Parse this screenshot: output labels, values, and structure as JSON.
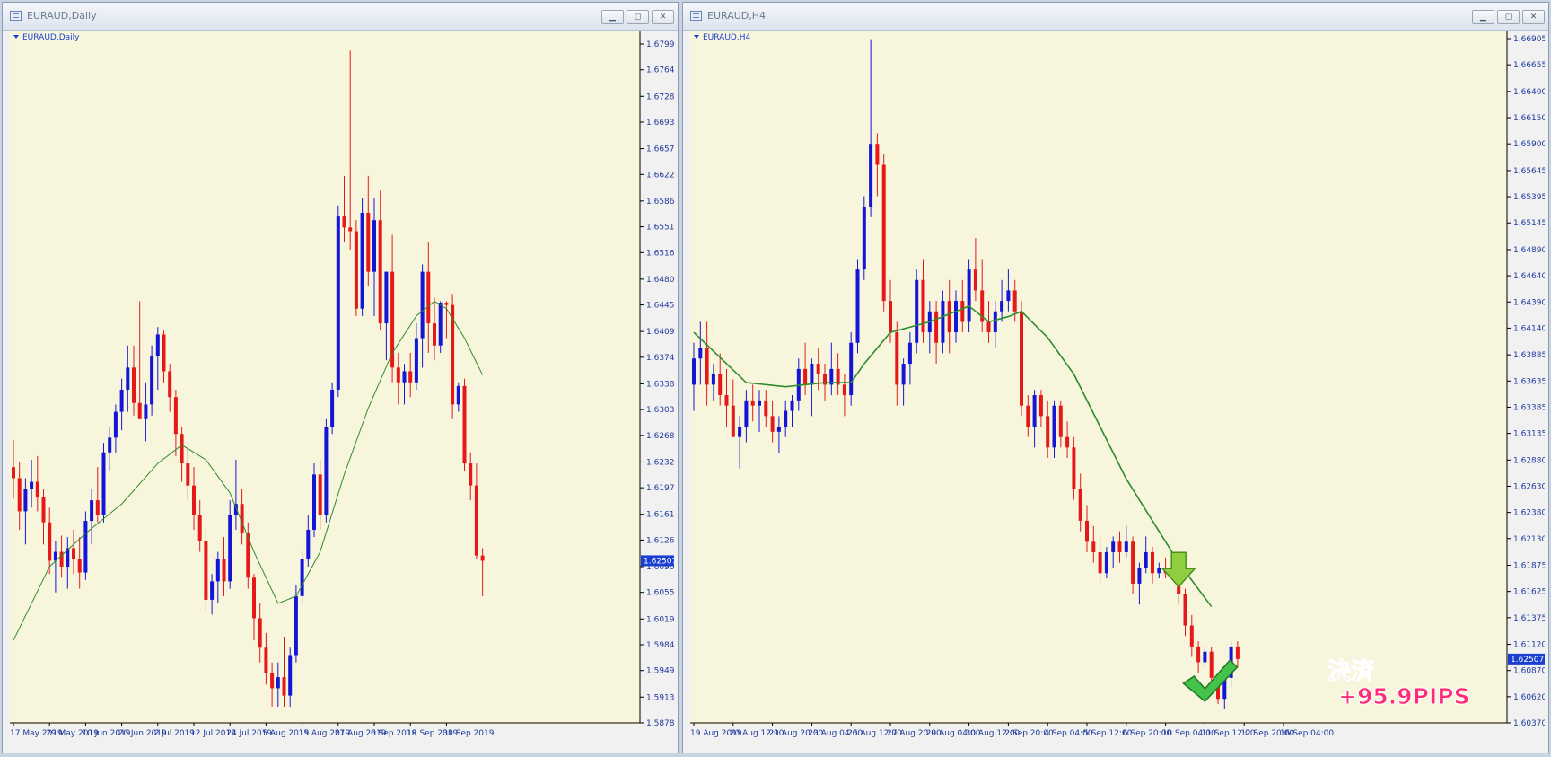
{
  "windows": {
    "left": {
      "title": "EURAUD,Daily",
      "label": "EURAUD,Daily",
      "price_tag": "1.62507",
      "y_ticks": [
        "1.67990",
        "1.67640",
        "1.67280",
        "1.66930",
        "1.66570",
        "1.66220",
        "1.65860",
        "1.65510",
        "1.65160",
        "1.64800",
        "1.64450",
        "1.64090",
        "1.63740",
        "1.63380",
        "1.63030",
        "1.62680",
        "1.62320",
        "1.61970",
        "1.61610",
        "1.61260",
        "1.60900",
        "1.60550",
        "1.60190",
        "1.59840",
        "1.59490",
        "1.59130",
        "1.58780"
      ],
      "x_ticks": [
        "17 May 2019",
        "29 May 2019",
        "10 Jun 2019",
        "20 Jun 2019",
        "2 Jul 2019",
        "12 Jul 2019",
        "24 Jul 2019",
        "5 Aug 2019",
        "15 Aug 2019",
        "27 Aug 2019",
        "6 Sep 2019",
        "18 Sep 2019",
        "30 Sep 2019"
      ]
    },
    "right": {
      "title": "EURAUD,H4",
      "label": "EURAUD,H4",
      "price_tag": "1.62507",
      "y_ticks": [
        "1.66905",
        "1.66655",
        "1.66400",
        "1.66150",
        "1.65900",
        "1.65645",
        "1.65395",
        "1.65145",
        "1.64890",
        "1.64640",
        "1.64390",
        "1.64140",
        "1.63885",
        "1.63635",
        "1.63385",
        "1.63135",
        "1.62880",
        "1.62630",
        "1.62380",
        "1.62130",
        "1.61875",
        "1.61625",
        "1.61375",
        "1.61120",
        "1.60870",
        "1.60620",
        "1.60370"
      ],
      "x_ticks": [
        "19 Aug 2019",
        "20 Aug 12:00",
        "21 Aug 20:00",
        "23 Aug 04:00",
        "26 Aug 12:00",
        "27 Aug 20:00",
        "29 Aug 04:00",
        "30 Aug 12:00",
        "2 Sep 20:00",
        "4 Sep 04:00",
        "5 Sep 12:00",
        "6 Sep 20:00",
        "10 Sep 04:00",
        "11 Sep 12:00",
        "12 Sep 20:00",
        "16 Sep 04:00"
      ],
      "annotation": {
        "line1": "決済",
        "line2": "+95.9PIPS"
      }
    }
  },
  "colors": {
    "background": "#f7f5dc",
    "bull": "#1515d6",
    "bear": "#e61919",
    "ma": "#2e8b2e",
    "axis_text": "#1f3a9e",
    "price_tag_bg": "#1a3fd0"
  },
  "chart_data": [
    {
      "type": "candlestick",
      "symbol": "EURAUD",
      "timeframe": "Daily",
      "ylim": [
        1.5878,
        1.6799
      ],
      "candles": [
        [
          1.6225,
          1.6262,
          1.6182,
          1.621
        ],
        [
          1.621,
          1.6232,
          1.614,
          1.6165
        ],
        [
          1.6165,
          1.621,
          1.612,
          1.6195
        ],
        [
          1.6195,
          1.6235,
          1.617,
          1.6205
        ],
        [
          1.6205,
          1.624,
          1.6165,
          1.6185
        ],
        [
          1.6185,
          1.6195,
          1.612,
          1.615
        ],
        [
          1.615,
          1.617,
          1.608,
          1.6098
        ],
        [
          1.6098,
          1.6125,
          1.6055,
          1.611
        ],
        [
          1.611,
          1.6132,
          1.6075,
          1.609
        ],
        [
          1.609,
          1.613,
          1.606,
          1.6115
        ],
        [
          1.6115,
          1.614,
          1.608,
          1.61
        ],
        [
          1.61,
          1.613,
          1.606,
          1.6082
        ],
        [
          1.6082,
          1.6165,
          1.6072,
          1.6152
        ],
        [
          1.6152,
          1.6195,
          1.612,
          1.618
        ],
        [
          1.618,
          1.6225,
          1.615,
          1.616
        ],
        [
          1.616,
          1.6258,
          1.615,
          1.6245
        ],
        [
          1.6245,
          1.628,
          1.622,
          1.6265
        ],
        [
          1.6265,
          1.631,
          1.6245,
          1.63
        ],
        [
          1.63,
          1.6345,
          1.6275,
          1.633
        ],
        [
          1.633,
          1.639,
          1.63,
          1.636
        ],
        [
          1.636,
          1.639,
          1.6295,
          1.6312
        ],
        [
          1.6312,
          1.645,
          1.6295,
          1.629
        ],
        [
          1.629,
          1.634,
          1.626,
          1.631
        ],
        [
          1.631,
          1.639,
          1.6295,
          1.6375
        ],
        [
          1.6375,
          1.6415,
          1.633,
          1.6405
        ],
        [
          1.6405,
          1.641,
          1.634,
          1.6355
        ],
        [
          1.6355,
          1.6365,
          1.63,
          1.632
        ],
        [
          1.632,
          1.633,
          1.624,
          1.627
        ],
        [
          1.627,
          1.628,
          1.6205,
          1.623
        ],
        [
          1.623,
          1.625,
          1.618,
          1.62
        ],
        [
          1.62,
          1.6225,
          1.614,
          1.616
        ],
        [
          1.616,
          1.618,
          1.611,
          1.6125
        ],
        [
          1.6125,
          1.614,
          1.603,
          1.6045
        ],
        [
          1.6045,
          1.608,
          1.6025,
          1.607
        ],
        [
          1.607,
          1.611,
          1.604,
          1.61
        ],
        [
          1.61,
          1.613,
          1.605,
          1.607
        ],
        [
          1.607,
          1.618,
          1.606,
          1.616
        ],
        [
          1.616,
          1.6235,
          1.614,
          1.6175
        ],
        [
          1.6175,
          1.6195,
          1.612,
          1.6135
        ],
        [
          1.6135,
          1.615,
          1.606,
          1.6075
        ],
        [
          1.6075,
          1.608,
          1.599,
          1.602
        ],
        [
          1.602,
          1.604,
          1.596,
          1.598
        ],
        [
          1.598,
          1.6,
          1.593,
          1.5945
        ],
        [
          1.5945,
          1.596,
          1.59,
          1.5925
        ],
        [
          1.5925,
          1.596,
          1.59,
          1.594
        ],
        [
          1.594,
          1.5995,
          1.59,
          1.5915
        ],
        [
          1.5915,
          1.598,
          1.59,
          1.597
        ],
        [
          1.597,
          1.6065,
          1.596,
          1.605
        ],
        [
          1.605,
          1.611,
          1.604,
          1.61
        ],
        [
          1.61,
          1.616,
          1.609,
          1.614
        ],
        [
          1.614,
          1.623,
          1.613,
          1.6215
        ],
        [
          1.6215,
          1.6235,
          1.614,
          1.616
        ],
        [
          1.616,
          1.629,
          1.615,
          1.628
        ],
        [
          1.628,
          1.634,
          1.627,
          1.633
        ],
        [
          1.633,
          1.658,
          1.632,
          1.6565
        ],
        [
          1.6565,
          1.662,
          1.653,
          1.655
        ],
        [
          1.655,
          1.679,
          1.652,
          1.6545
        ],
        [
          1.6545,
          1.656,
          1.643,
          1.644
        ],
        [
          1.644,
          1.659,
          1.643,
          1.657
        ],
        [
          1.657,
          1.662,
          1.647,
          1.649
        ],
        [
          1.649,
          1.659,
          1.643,
          1.656
        ],
        [
          1.656,
          1.66,
          1.641,
          1.642
        ],
        [
          1.642,
          1.649,
          1.637,
          1.649
        ],
        [
          1.649,
          1.654,
          1.634,
          1.636
        ],
        [
          1.636,
          1.638,
          1.631,
          1.634
        ],
        [
          1.634,
          1.6365,
          1.631,
          1.6355
        ],
        [
          1.6355,
          1.638,
          1.632,
          1.634
        ],
        [
          1.634,
          1.642,
          1.633,
          1.64
        ],
        [
          1.64,
          1.65,
          1.636,
          1.649
        ],
        [
          1.649,
          1.653,
          1.638,
          1.642
        ],
        [
          1.642,
          1.6455,
          1.637,
          1.639
        ],
        [
          1.639,
          1.645,
          1.638,
          1.6448
        ],
        [
          1.6448,
          1.645,
          1.64,
          1.6445
        ],
        [
          1.6445,
          1.646,
          1.629,
          1.631
        ],
        [
          1.631,
          1.634,
          1.63,
          1.6335
        ],
        [
          1.6335,
          1.6345,
          1.622,
          1.623
        ],
        [
          1.623,
          1.6245,
          1.618,
          1.62
        ],
        [
          1.62,
          1.623,
          1.61,
          1.6105
        ],
        [
          1.6105,
          1.6115,
          1.605,
          1.6098
        ]
      ],
      "ma": [
        [
          0,
          1.599
        ],
        [
          6,
          1.609
        ],
        [
          12,
          1.6135
        ],
        [
          18,
          1.6175
        ],
        [
          24,
          1.623
        ],
        [
          28,
          1.6255
        ],
        [
          32,
          1.6235
        ],
        [
          36,
          1.619
        ],
        [
          40,
          1.611
        ],
        [
          44,
          1.604
        ],
        [
          47,
          1.605
        ],
        [
          51,
          1.611
        ],
        [
          55,
          1.6215
        ],
        [
          59,
          1.6305
        ],
        [
          63,
          1.638
        ],
        [
          67,
          1.643
        ],
        [
          70,
          1.645
        ],
        [
          72,
          1.644
        ],
        [
          75,
          1.64
        ],
        [
          78,
          1.635
        ]
      ],
      "x_tick_index": [
        0,
        6,
        12,
        18,
        24,
        30,
        36,
        42,
        48,
        54,
        60,
        66,
        72
      ]
    },
    {
      "type": "candlestick",
      "symbol": "EURAUD",
      "timeframe": "H4",
      "ylim": [
        1.6037,
        1.66905
      ],
      "candles": [
        [
          1.636,
          1.64,
          1.6335,
          1.6385
        ],
        [
          1.6385,
          1.642,
          1.636,
          1.6395
        ],
        [
          1.6395,
          1.642,
          1.634,
          1.636
        ],
        [
          1.636,
          1.638,
          1.6345,
          1.637
        ],
        [
          1.637,
          1.639,
          1.634,
          1.635
        ],
        [
          1.635,
          1.6375,
          1.632,
          1.634
        ],
        [
          1.634,
          1.6365,
          1.632,
          1.631
        ],
        [
          1.631,
          1.633,
          1.628,
          1.632
        ],
        [
          1.632,
          1.6355,
          1.6305,
          1.6345
        ],
        [
          1.6345,
          1.636,
          1.6325,
          1.634
        ],
        [
          1.634,
          1.6355,
          1.6315,
          1.6345
        ],
        [
          1.6345,
          1.6355,
          1.632,
          1.633
        ],
        [
          1.633,
          1.6345,
          1.6305,
          1.6315
        ],
        [
          1.6315,
          1.633,
          1.6295,
          1.632
        ],
        [
          1.632,
          1.6345,
          1.631,
          1.6335
        ],
        [
          1.6335,
          1.635,
          1.632,
          1.6345
        ],
        [
          1.6345,
          1.6385,
          1.6335,
          1.6375
        ],
        [
          1.6375,
          1.64,
          1.635,
          1.636
        ],
        [
          1.636,
          1.6385,
          1.633,
          1.638
        ],
        [
          1.638,
          1.6395,
          1.6355,
          1.637
        ],
        [
          1.637,
          1.638,
          1.6345,
          1.636
        ],
        [
          1.636,
          1.64,
          1.635,
          1.6375
        ],
        [
          1.6375,
          1.639,
          1.635,
          1.636
        ],
        [
          1.636,
          1.637,
          1.633,
          1.635
        ],
        [
          1.635,
          1.641,
          1.634,
          1.64
        ],
        [
          1.64,
          1.648,
          1.639,
          1.647
        ],
        [
          1.647,
          1.654,
          1.646,
          1.653
        ],
        [
          1.653,
          1.669,
          1.652,
          1.659
        ],
        [
          1.659,
          1.66,
          1.654,
          1.657
        ],
        [
          1.657,
          1.658,
          1.643,
          1.644
        ],
        [
          1.644,
          1.646,
          1.64,
          1.641
        ],
        [
          1.641,
          1.642,
          1.634,
          1.636
        ],
        [
          1.636,
          1.6385,
          1.634,
          1.638
        ],
        [
          1.638,
          1.641,
          1.636,
          1.64
        ],
        [
          1.64,
          1.647,
          1.639,
          1.646
        ],
        [
          1.646,
          1.648,
          1.64,
          1.641
        ],
        [
          1.641,
          1.644,
          1.639,
          1.643
        ],
        [
          1.643,
          1.644,
          1.638,
          1.64
        ],
        [
          1.64,
          1.645,
          1.639,
          1.644
        ],
        [
          1.644,
          1.646,
          1.639,
          1.641
        ],
        [
          1.641,
          1.645,
          1.64,
          1.644
        ],
        [
          1.644,
          1.646,
          1.641,
          1.642
        ],
        [
          1.642,
          1.648,
          1.641,
          1.647
        ],
        [
          1.647,
          1.65,
          1.644,
          1.645
        ],
        [
          1.645,
          1.648,
          1.641,
          1.642
        ],
        [
          1.642,
          1.644,
          1.64,
          1.641
        ],
        [
          1.641,
          1.644,
          1.6395,
          1.643
        ],
        [
          1.643,
          1.646,
          1.642,
          1.644
        ],
        [
          1.644,
          1.647,
          1.643,
          1.645
        ],
        [
          1.645,
          1.646,
          1.642,
          1.643
        ],
        [
          1.643,
          1.644,
          1.633,
          1.634
        ],
        [
          1.634,
          1.635,
          1.631,
          1.632
        ],
        [
          1.632,
          1.6355,
          1.63,
          1.635
        ],
        [
          1.635,
          1.6355,
          1.632,
          1.633
        ],
        [
          1.633,
          1.6345,
          1.629,
          1.63
        ],
        [
          1.63,
          1.6345,
          1.629,
          1.634
        ],
        [
          1.634,
          1.6345,
          1.63,
          1.631
        ],
        [
          1.631,
          1.6325,
          1.629,
          1.63
        ],
        [
          1.63,
          1.631,
          1.625,
          1.626
        ],
        [
          1.626,
          1.6275,
          1.622,
          1.623
        ],
        [
          1.623,
          1.6245,
          1.62,
          1.621
        ],
        [
          1.621,
          1.6225,
          1.619,
          1.62
        ],
        [
          1.62,
          1.6215,
          1.617,
          1.618
        ],
        [
          1.618,
          1.6205,
          1.6175,
          1.62
        ],
        [
          1.62,
          1.6215,
          1.6185,
          1.621
        ],
        [
          1.621,
          1.622,
          1.619,
          1.62
        ],
        [
          1.62,
          1.6225,
          1.6195,
          1.621
        ],
        [
          1.621,
          1.6215,
          1.616,
          1.617
        ],
        [
          1.617,
          1.619,
          1.615,
          1.6185
        ],
        [
          1.6185,
          1.6215,
          1.618,
          1.62
        ],
        [
          1.62,
          1.6205,
          1.617,
          1.618
        ],
        [
          1.618,
          1.619,
          1.6175,
          1.6185
        ],
        [
          1.6185,
          1.6195,
          1.6175,
          1.618
        ],
        [
          1.618,
          1.6195,
          1.6175,
          1.6185
        ],
        [
          1.6185,
          1.619,
          1.615,
          1.616
        ],
        [
          1.616,
          1.6165,
          1.612,
          1.613
        ],
        [
          1.613,
          1.614,
          1.61,
          1.611
        ],
        [
          1.611,
          1.6115,
          1.6085,
          1.6095
        ],
        [
          1.6095,
          1.611,
          1.609,
          1.6105
        ],
        [
          1.6105,
          1.611,
          1.607,
          1.608
        ],
        [
          1.608,
          1.6085,
          1.6055,
          1.606
        ],
        [
          1.606,
          1.609,
          1.605,
          1.608
        ],
        [
          1.608,
          1.6115,
          1.607,
          1.611
        ],
        [
          1.611,
          1.6115,
          1.609,
          1.6098
        ]
      ],
      "ma": [
        [
          0,
          1.641
        ],
        [
          8,
          1.6362
        ],
        [
          14,
          1.6358
        ],
        [
          20,
          1.6362
        ],
        [
          24,
          1.6362
        ],
        [
          26,
          1.638
        ],
        [
          30,
          1.641
        ],
        [
          36,
          1.642
        ],
        [
          42,
          1.6435
        ],
        [
          45,
          1.642
        ],
        [
          48,
          1.6425
        ],
        [
          50,
          1.643
        ],
        [
          54,
          1.6405
        ],
        [
          58,
          1.637
        ],
        [
          62,
          1.632
        ],
        [
          66,
          1.627
        ],
        [
          70,
          1.623
        ],
        [
          74,
          1.619
        ],
        [
          79,
          1.6148
        ]
      ],
      "x_tick_index": [
        0,
        6,
        12,
        18,
        24,
        30,
        36,
        42,
        48,
        54,
        60,
        66,
        72,
        78,
        84,
        90
      ],
      "markers": [
        {
          "type": "down-arrow",
          "index": 74
        },
        {
          "type": "checkmark",
          "index": 78
        }
      ]
    }
  ]
}
